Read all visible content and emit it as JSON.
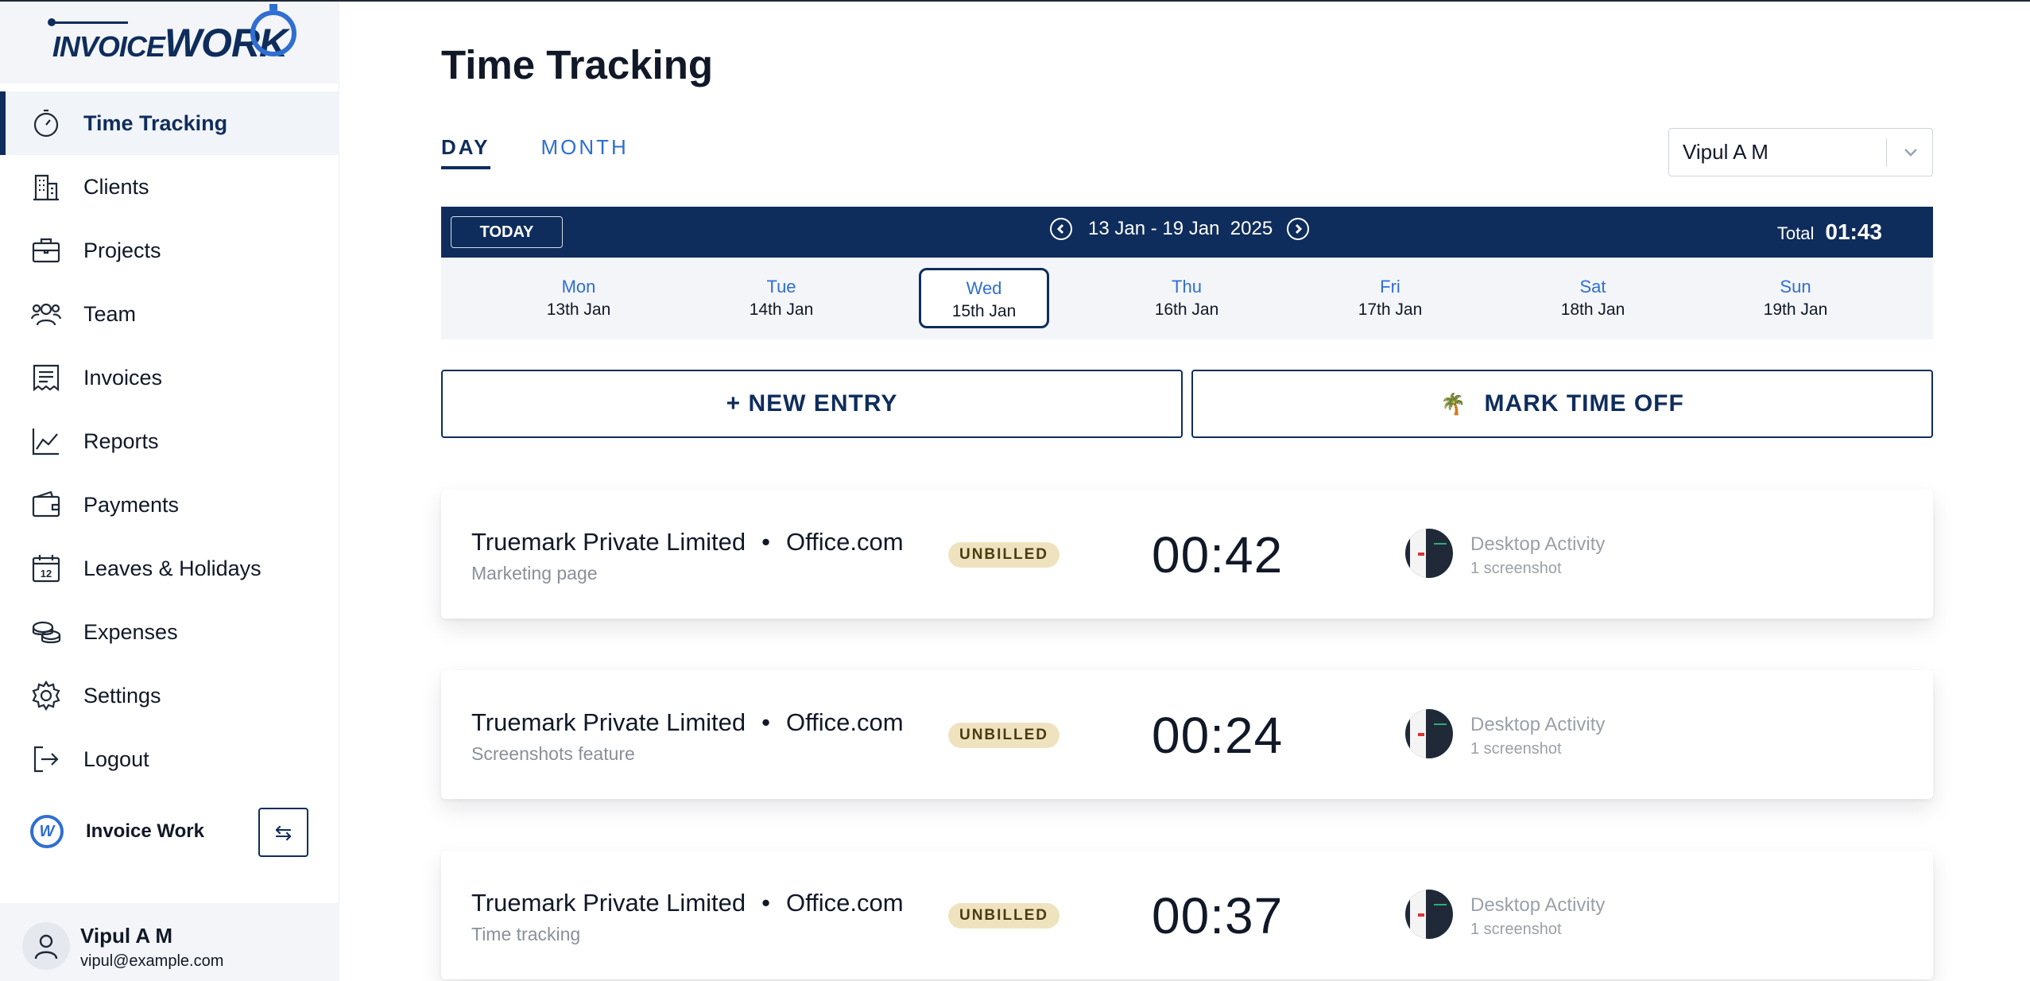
{
  "brand": {
    "logo_left": "INVOICE",
    "logo_right": "WORK"
  },
  "sidebar": {
    "items": [
      {
        "label": "Time Tracking",
        "icon": "stopwatch-icon",
        "active": true
      },
      {
        "label": "Clients",
        "icon": "building-icon"
      },
      {
        "label": "Projects",
        "icon": "briefcase-icon"
      },
      {
        "label": "Team",
        "icon": "team-icon"
      },
      {
        "label": "Invoices",
        "icon": "invoice-icon"
      },
      {
        "label": "Reports",
        "icon": "chart-line-icon"
      },
      {
        "label": "Payments",
        "icon": "wallet-icon"
      },
      {
        "label": "Leaves & Holidays",
        "icon": "calendar-icon",
        "calendar_day": "12"
      },
      {
        "label": "Expenses",
        "icon": "coins-icon"
      },
      {
        "label": "Settings",
        "icon": "gear-icon"
      },
      {
        "label": "Logout",
        "icon": "logout-icon"
      }
    ],
    "workspace": {
      "icon_letter": "W",
      "name": "Invoice Work",
      "switch_icon": "⇆"
    },
    "user": {
      "name": "Vipul A M",
      "email": "vipul@example.com"
    }
  },
  "main": {
    "title": "Time Tracking",
    "tabs": [
      {
        "label": "DAY",
        "active": true
      },
      {
        "label": "MONTH"
      }
    ],
    "user_select": {
      "value": "Vipul A M"
    },
    "week": {
      "today_label": "TODAY",
      "range": "13 Jan - 19 Jan",
      "year": "2025",
      "total_label": "Total",
      "total_value": "01:43"
    },
    "days": [
      {
        "name": "Mon",
        "date": "13th Jan"
      },
      {
        "name": "Tue",
        "date": "14th Jan"
      },
      {
        "name": "Wed",
        "date": "15th Jan",
        "active": true
      },
      {
        "name": "Thu",
        "date": "16th Jan"
      },
      {
        "name": "Fri",
        "date": "17th Jan"
      },
      {
        "name": "Sat",
        "date": "18th Jan"
      },
      {
        "name": "Sun",
        "date": "19th Jan"
      }
    ],
    "actions": {
      "new_entry": "+ NEW ENTRY",
      "mark_time_off": "MARK TIME OFF",
      "mark_time_off_icon": "palm-tree-icon"
    },
    "entries": [
      {
        "client": "Truemark Private Limited",
        "separator": "•",
        "project": "Office.com",
        "description": "Marketing page",
        "status": "UNBILLED",
        "duration": "00:42",
        "activity_title": "Desktop Activity",
        "activity_sub": "1 screenshot"
      },
      {
        "client": "Truemark Private Limited",
        "separator": "•",
        "project": "Office.com",
        "description": "Screenshots feature",
        "status": "UNBILLED",
        "duration": "00:24",
        "activity_title": "Desktop Activity",
        "activity_sub": "1 screenshot"
      },
      {
        "client": "Truemark Private Limited",
        "separator": "•",
        "project": "Office.com",
        "description": "Time tracking",
        "status": "UNBILLED",
        "duration": "00:37",
        "activity_title": "Desktop Activity",
        "activity_sub": "1 screenshot"
      }
    ]
  },
  "colors": {
    "navy": "#0f2d5c",
    "accent_blue": "#2f6fd1",
    "badge_bg": "#efe3bf",
    "panel_bg": "#f3f5f8"
  }
}
